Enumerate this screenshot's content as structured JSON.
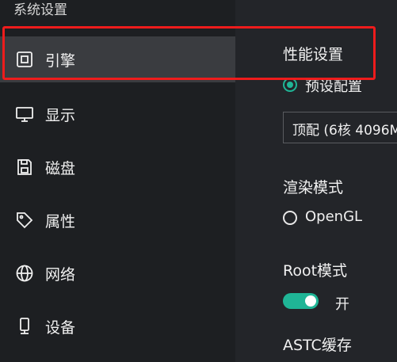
{
  "window": {
    "title": "系统设置"
  },
  "sidebar": {
    "items": [
      {
        "label": "引擎",
        "icon": "cpu-icon",
        "active": true
      },
      {
        "label": "显示",
        "icon": "monitor-icon",
        "active": false
      },
      {
        "label": "磁盘",
        "icon": "disk-icon",
        "active": false
      },
      {
        "label": "属性",
        "icon": "tag-icon",
        "active": false
      },
      {
        "label": "网络",
        "icon": "globe-icon",
        "active": false
      },
      {
        "label": "设备",
        "icon": "phone-icon",
        "active": false
      }
    ]
  },
  "main": {
    "performance": {
      "title": "性能设置",
      "preset_option": "预设配置",
      "preset_selected": true,
      "select_value": "顶配 (6核 4096M"
    },
    "render": {
      "title": "渲染模式",
      "option": "OpenGL",
      "selected": false
    },
    "root": {
      "title": "Root模式",
      "toggle_on": true,
      "toggle_label": "开"
    },
    "astc": {
      "title": "ASTC缓存"
    }
  },
  "colors": {
    "accent": "#1fb596",
    "highlight": "#ee1c1c",
    "sidebar_bg": "#1d1f22",
    "content_bg": "#232529",
    "active_item_bg": "#3a3c40"
  }
}
